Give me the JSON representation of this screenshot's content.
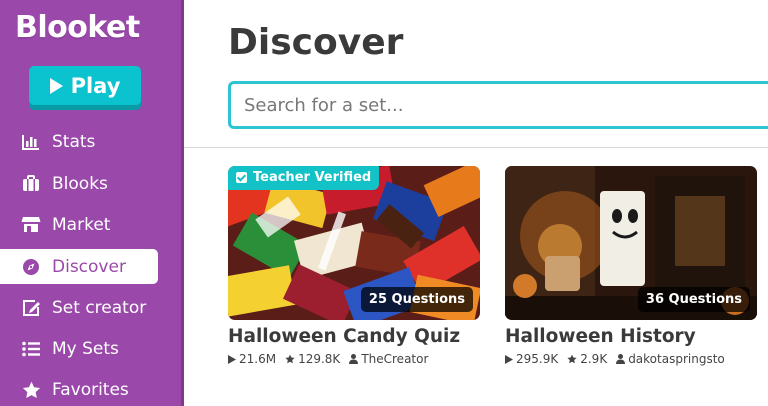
{
  "app": {
    "logo": "Blooket",
    "play_label": "Play"
  },
  "sidebar": {
    "items": [
      {
        "label": "Stats",
        "icon": "bar-chart-icon"
      },
      {
        "label": "Blooks",
        "icon": "blooks-icon"
      },
      {
        "label": "Market",
        "icon": "store-icon"
      },
      {
        "label": "Discover",
        "icon": "compass-icon",
        "active": true
      },
      {
        "label": "Set creator",
        "icon": "edit-icon"
      },
      {
        "label": "My Sets",
        "icon": "list-icon"
      },
      {
        "label": "Favorites",
        "icon": "star-icon"
      }
    ]
  },
  "main": {
    "title": "Discover",
    "search_placeholder": "Search for a set..."
  },
  "cards": [
    {
      "title": "Halloween Candy Quiz",
      "questions": "25 Questions",
      "verified": "Teacher Verified",
      "plays": "21.6M",
      "favorites": "129.8K",
      "author": "TheCreator"
    },
    {
      "title": "Halloween History",
      "questions": "36 Questions",
      "plays": "295.9K",
      "favorites": "2.9K",
      "author": "dakotaspringsto"
    }
  ],
  "colors": {
    "sidebar": "#9a49aa",
    "accent": "#0bc2cf",
    "search_border": "#2ec4d2",
    "verified": "#12c2c7"
  }
}
